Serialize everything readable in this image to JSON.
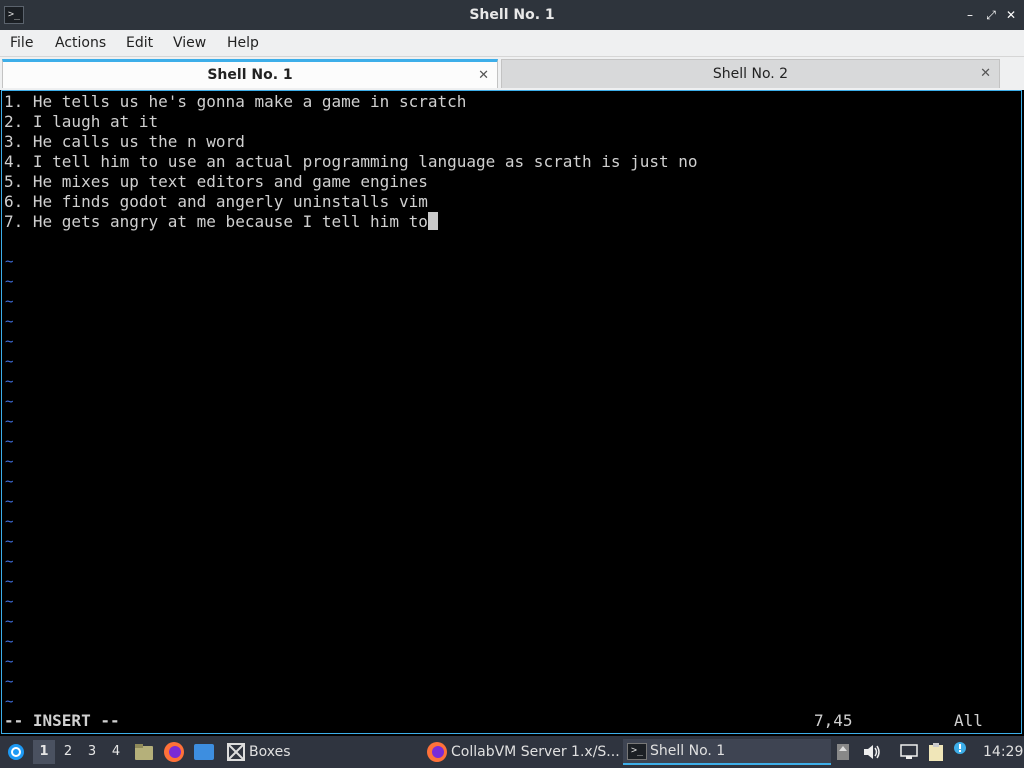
{
  "window": {
    "title": "Shell No. 1"
  },
  "menu": [
    "File",
    "Actions",
    "Edit",
    "View",
    "Help"
  ],
  "tabs": [
    {
      "label": "Shell No. 1",
      "active": true
    },
    {
      "label": "Shell No. 2",
      "active": false
    }
  ],
  "terminal": {
    "lines": [
      "1. He tells us he's gonna make a game in scratch",
      "2. I laugh at it",
      "3. He calls us the n word",
      "4. I tell him to use an actual programming language as scrath is just no",
      "5. He mixes up text editors and game engines",
      "6. He finds godot and angerly uninstalls vim",
      "7. He gets angry at me because I tell him to"
    ],
    "tilde": "~",
    "mode": "-- INSERT --",
    "cursor_position": "7,45",
    "scroll": "All"
  },
  "taskbar": {
    "workspaces": [
      "1",
      "2",
      "3",
      "4"
    ],
    "tasks": [
      "Boxes",
      "CollabVM Server 1.x/S...",
      "Shell No. 1"
    ],
    "clock": "14:29"
  },
  "colors": {
    "accent": "#3daee9",
    "tilde": "#3f6fe0",
    "taskbar": "#2f343f"
  }
}
